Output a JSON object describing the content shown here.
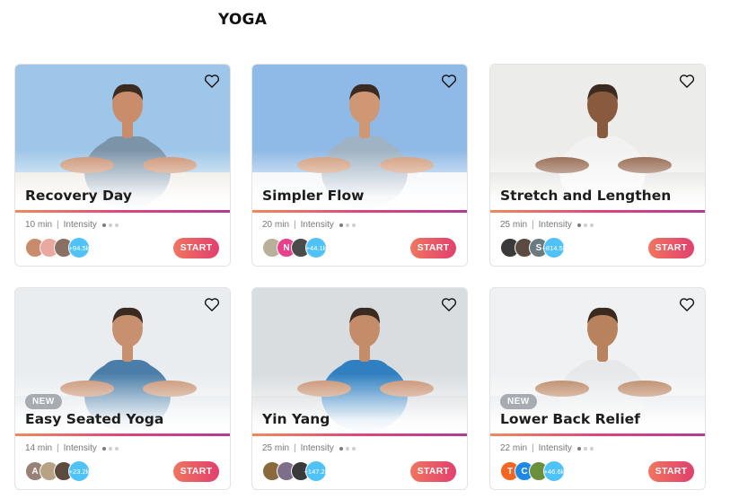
{
  "page": {
    "title": "YOGA"
  },
  "cards": [
    {
      "title": "Recovery Day",
      "duration": "10 min",
      "intensity_label": "Intensity",
      "intensity_level": 1,
      "intensity_max": 3,
      "badge": "",
      "participants": "+94.5k",
      "avatar_letters": [
        "",
        "",
        ""
      ],
      "avatar_colors": [
        "#c98b6b",
        "#e9a8a0",
        "#8a6f63"
      ],
      "start_label": "START",
      "photo": {
        "sky": "#9ec6e8",
        "skin": "#c98d6c",
        "shirt": "#7c94a8",
        "floor": "#e9e4da"
      }
    },
    {
      "title": "Simpler Flow",
      "duration": "20 min",
      "intensity_label": "Intensity",
      "intensity_level": 1,
      "intensity_max": 3,
      "badge": "",
      "participants": "+44.1k",
      "avatar_letters": [
        "",
        "N",
        ""
      ],
      "avatar_colors": [
        "#b9b09a",
        "#e8418a",
        "#4b4b4b"
      ],
      "start_label": "START",
      "photo": {
        "sky": "#8fb9e6",
        "skin": "#cf9774",
        "shirt": "#9fb3c4",
        "floor": "#eef2f6"
      }
    },
    {
      "title": "Stretch and Lengthen",
      "duration": "25 min",
      "intensity_label": "Intensity",
      "intensity_level": 1,
      "intensity_max": 3,
      "badge": "",
      "participants": "+814.5k",
      "avatar_letters": [
        "",
        "",
        "S"
      ],
      "avatar_colors": [
        "#3a3a3a",
        "#5a4a40",
        "#6b7a80"
      ],
      "start_label": "START",
      "photo": {
        "sky": "#ececea",
        "skin": "#8a5a3e",
        "shirt": "#f2f2f2",
        "floor": "#d9d9d6"
      }
    },
    {
      "title": "Easy Seated Yoga",
      "duration": "14 min",
      "intensity_label": "Intensity",
      "intensity_level": 1,
      "intensity_max": 3,
      "badge": "NEW",
      "participants": "+23.2k",
      "avatar_letters": [
        "A",
        "",
        ""
      ],
      "avatar_colors": [
        "#9a8178",
        "#b7a286",
        "#5d4a3f"
      ],
      "start_label": "START",
      "photo": {
        "sky": "#e9edf0",
        "skin": "#c79170",
        "shirt": "#4a7ea8",
        "floor": "#dde3e8"
      }
    },
    {
      "title": "Yin Yang",
      "duration": "25 min",
      "intensity_label": "Intensity",
      "intensity_level": 1,
      "intensity_max": 3,
      "badge": "",
      "participants": "+147.2k",
      "avatar_letters": [
        "",
        "",
        ""
      ],
      "avatar_colors": [
        "#8a6a3a",
        "#7d6f8a",
        "#3a3a3a"
      ],
      "start_label": "START",
      "photo": {
        "sky": "#d9dde0",
        "skin": "#c58c6a",
        "shirt": "#2f7fc1",
        "floor": "#cfd3d6"
      }
    },
    {
      "title": "Lower Back Relief",
      "duration": "22 min",
      "intensity_label": "Intensity",
      "intensity_level": 1,
      "intensity_max": 3,
      "badge": "NEW",
      "participants": "+46.6k",
      "avatar_letters": [
        "T",
        "C",
        ""
      ],
      "avatar_colors": [
        "#f26522",
        "#1e88e5",
        "#6b8f3a"
      ],
      "start_label": "START",
      "photo": {
        "sky": "#f0f1f2",
        "skin": "#b9825e",
        "shirt": "#e6e8ea",
        "floor": "#e3e5e7"
      }
    }
  ]
}
